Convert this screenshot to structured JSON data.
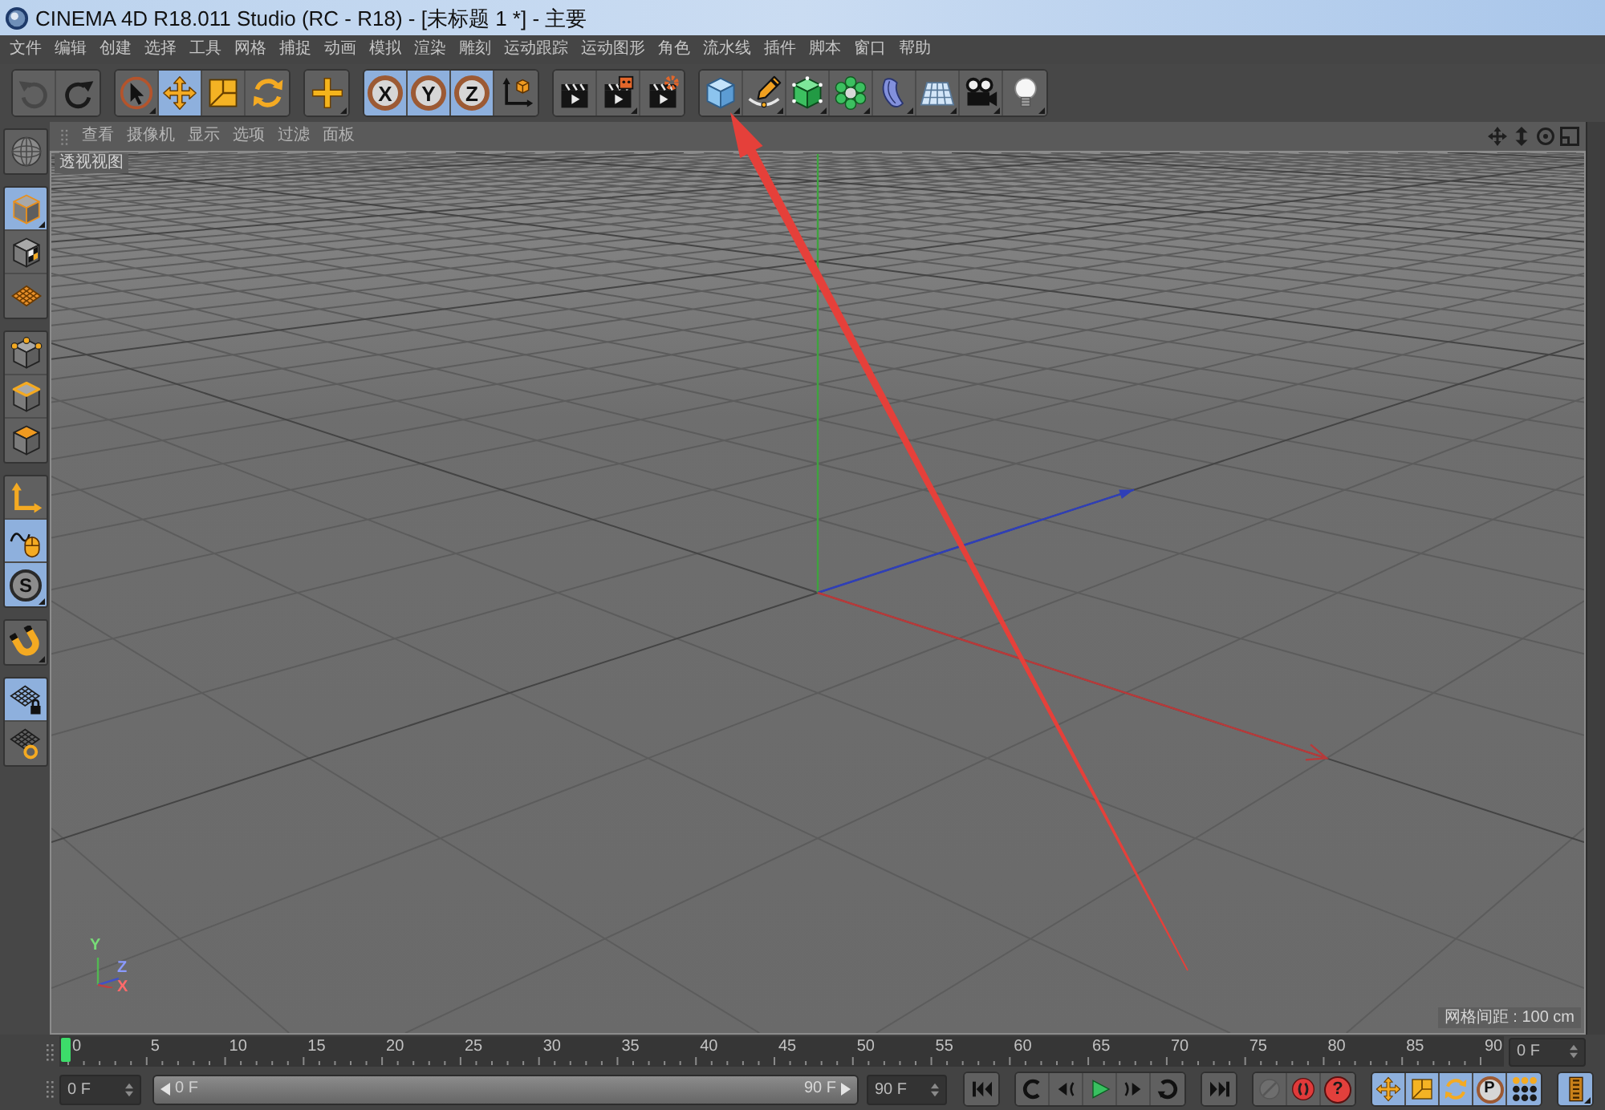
{
  "window": {
    "title": "CINEMA 4D R18.011 Studio (RC - R18) - [未标题 1 *] - 主要"
  },
  "menu_bar": [
    "文件",
    "编辑",
    "创建",
    "选择",
    "工具",
    "网格",
    "捕捉",
    "动画",
    "模拟",
    "渲染",
    "雕刻",
    "运动跟踪",
    "运动图形",
    "角色",
    "流水线",
    "插件",
    "脚本",
    "窗口",
    "帮助"
  ],
  "toolbar": [
    [
      {
        "kind": "undo",
        "disabled": true
      },
      {
        "kind": "redo",
        "disabled": false
      }
    ],
    [
      {
        "kind": "select",
        "selected": false
      },
      {
        "kind": "move",
        "selected": true
      },
      {
        "kind": "scale",
        "selected": false
      },
      {
        "kind": "rotate",
        "selected": false
      }
    ],
    [
      {
        "kind": "recent",
        "selected": false
      }
    ],
    [
      {
        "kind": "axis",
        "label": "X",
        "selected": true
      },
      {
        "kind": "axis",
        "label": "Y",
        "selected": true
      },
      {
        "kind": "axis",
        "label": "Z",
        "selected": true
      },
      {
        "kind": "coords",
        "selected": false
      }
    ],
    [
      {
        "kind": "render"
      },
      {
        "kind": "picture"
      },
      {
        "kind": "settings"
      }
    ],
    [
      {
        "kind": "cube"
      },
      {
        "kind": "spline"
      },
      {
        "kind": "subdivide"
      },
      {
        "kind": "cloner"
      },
      {
        "kind": "deformer"
      },
      {
        "kind": "floor"
      },
      {
        "kind": "camera"
      },
      {
        "kind": "light"
      }
    ]
  ],
  "left_toolbar": [
    [
      {
        "kind": "sphere",
        "selected": false
      }
    ],
    [
      {
        "kind": "model",
        "selected": true
      },
      {
        "kind": "texture",
        "selected": false
      },
      {
        "kind": "workplane",
        "selected": false
      }
    ],
    [
      {
        "kind": "points",
        "selected": false
      },
      {
        "kind": "edges",
        "selected": false
      },
      {
        "kind": "polygons",
        "selected": false
      }
    ],
    [
      {
        "kind": "axismode",
        "selected": false
      },
      {
        "kind": "tweak",
        "selected": true
      },
      {
        "kind": "solo",
        "label": "S",
        "selected": true
      }
    ],
    [
      {
        "kind": "snap",
        "selected": false
      }
    ],
    [
      {
        "kind": "locked",
        "selected": true
      },
      {
        "kind": "planar",
        "selected": false
      }
    ]
  ],
  "viewport": {
    "menu": [
      "查看",
      "摄像机",
      "显示",
      "选项",
      "过滤",
      "面板"
    ],
    "label": "透视视图",
    "grid_spacing": "网格间距 : 100 cm",
    "axis_gizmo": [
      {
        "label": "Y",
        "color": "#78dc78"
      },
      {
        "label": "Z",
        "color": "#8a9aff"
      },
      {
        "label": "X",
        "color": "#ff6a6a"
      }
    ]
  },
  "timeline": {
    "ticks": [
      "0",
      "5",
      "10",
      "15",
      "20",
      "25",
      "30",
      "35",
      "40",
      "45",
      "50",
      "55",
      "60",
      "65",
      "70",
      "75",
      "80",
      "85",
      "90"
    ],
    "playhead": {
      "level": 0
    },
    "frame_field": "0 F"
  },
  "transport": {
    "current_frame": "0 F",
    "range_slider": {
      "start": "0 F",
      "end": "90 F",
      "level": 1
    },
    "end_frame": "90 F",
    "buttons": [
      [
        {
          "kind": "start"
        }
      ],
      [
        {
          "kind": "prevkey"
        },
        {
          "kind": "prevframe"
        },
        {
          "kind": "play"
        },
        {
          "kind": "nextframe"
        },
        {
          "kind": "nextkey"
        }
      ],
      [
        {
          "kind": "end"
        }
      ],
      [
        {
          "kind": "keyoff",
          "disabled": true
        },
        {
          "kind": "record",
          "disabled": false
        },
        {
          "kind": "autokey",
          "label": "?",
          "disabled": false
        }
      ],
      [
        {
          "kind": "keymove",
          "selected": true
        },
        {
          "kind": "keyscale",
          "selected": true
        },
        {
          "kind": "keyrotate",
          "selected": true
        },
        {
          "kind": "keyparam",
          "label": "P",
          "selected": true
        },
        {
          "kind": "keypla",
          "selected": true
        }
      ],
      [
        {
          "kind": "timeline",
          "selected": true
        }
      ]
    ]
  }
}
